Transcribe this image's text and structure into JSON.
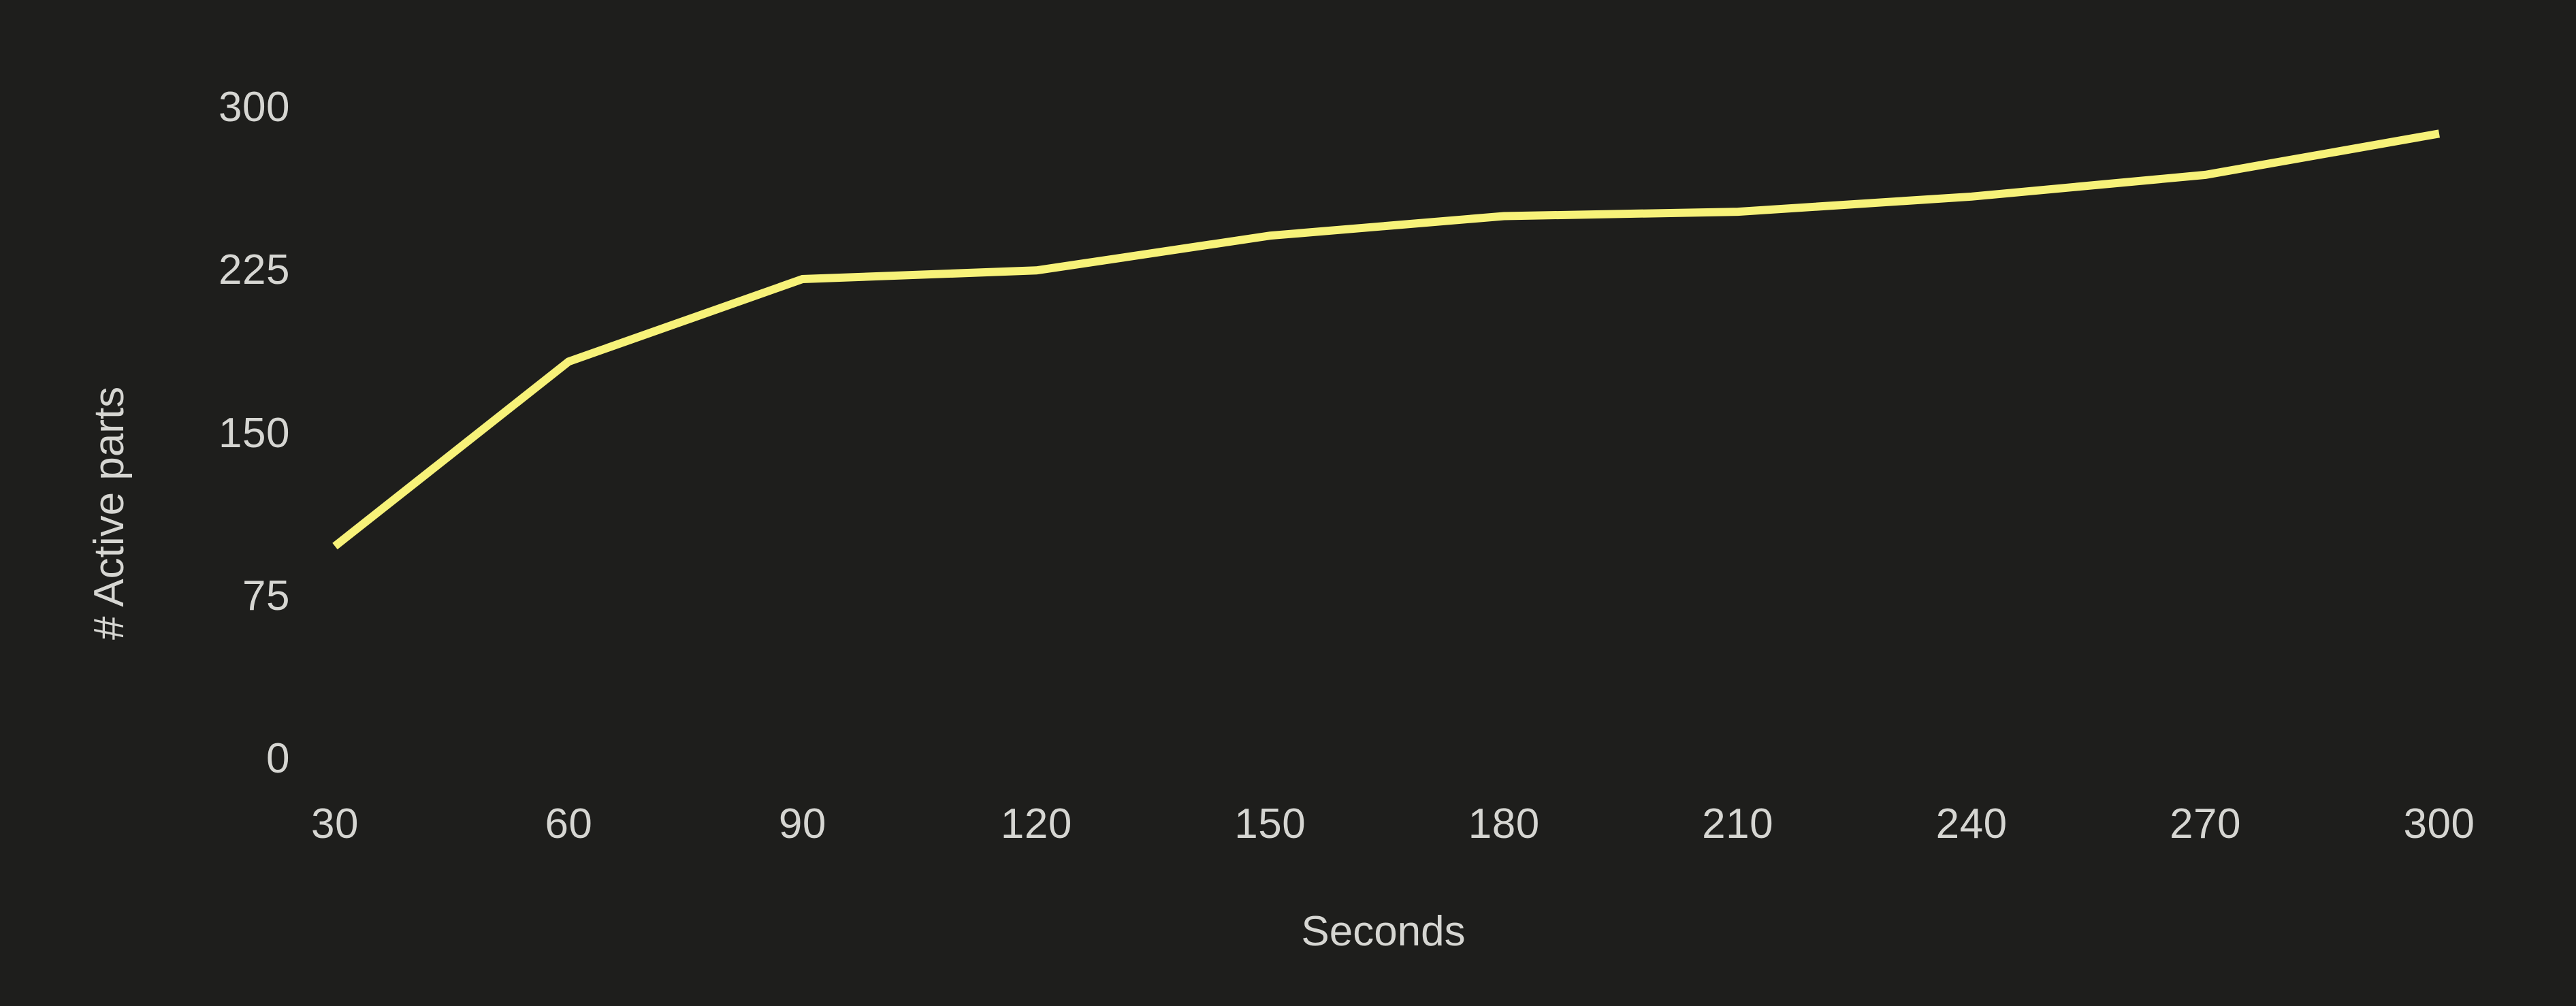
{
  "chart_data": {
    "type": "line",
    "title": "",
    "xlabel": "Seconds",
    "ylabel": "# Active parts",
    "x": [
      30,
      60,
      90,
      120,
      150,
      180,
      210,
      240,
      270,
      300
    ],
    "values": [
      98,
      183,
      221,
      225,
      241,
      250,
      252,
      259,
      269,
      288
    ],
    "series": [
      {
        "name": "# Active parts",
        "values": [
          98,
          183,
          221,
          225,
          241,
          250,
          252,
          259,
          269,
          288
        ],
        "color": "#f7f279"
      }
    ],
    "xlim": [
      30,
      300
    ],
    "ylim": [
      0,
      300
    ],
    "xticks": [
      "30",
      "60",
      "90",
      "120",
      "150",
      "180",
      "210",
      "240",
      "270",
      "300"
    ],
    "yticks": [
      "0",
      "75",
      "150",
      "225",
      "300"
    ],
    "grid": false,
    "legend": false,
    "background_color": "#1e1e1c",
    "text_color": "#d6d6d2",
    "line_color": "#f7f279",
    "line_width": 12
  },
  "axes": {
    "y_title": "# Active parts",
    "x_title": "Seconds",
    "y_ticks": [
      {
        "label": "300",
        "value": 300
      },
      {
        "label": "225",
        "value": 225
      },
      {
        "label": "150",
        "value": 150
      },
      {
        "label": "75",
        "value": 75
      },
      {
        "label": "0",
        "value": 0
      }
    ],
    "x_ticks": [
      {
        "label": "30",
        "value": 30
      },
      {
        "label": "60",
        "value": 60
      },
      {
        "label": "90",
        "value": 90
      },
      {
        "label": "120",
        "value": 120
      },
      {
        "label": "150",
        "value": 150
      },
      {
        "label": "180",
        "value": 180
      },
      {
        "label": "210",
        "value": 210
      },
      {
        "label": "240",
        "value": 240
      },
      {
        "label": "270",
        "value": 270
      },
      {
        "label": "300",
        "value": 300
      }
    ]
  }
}
